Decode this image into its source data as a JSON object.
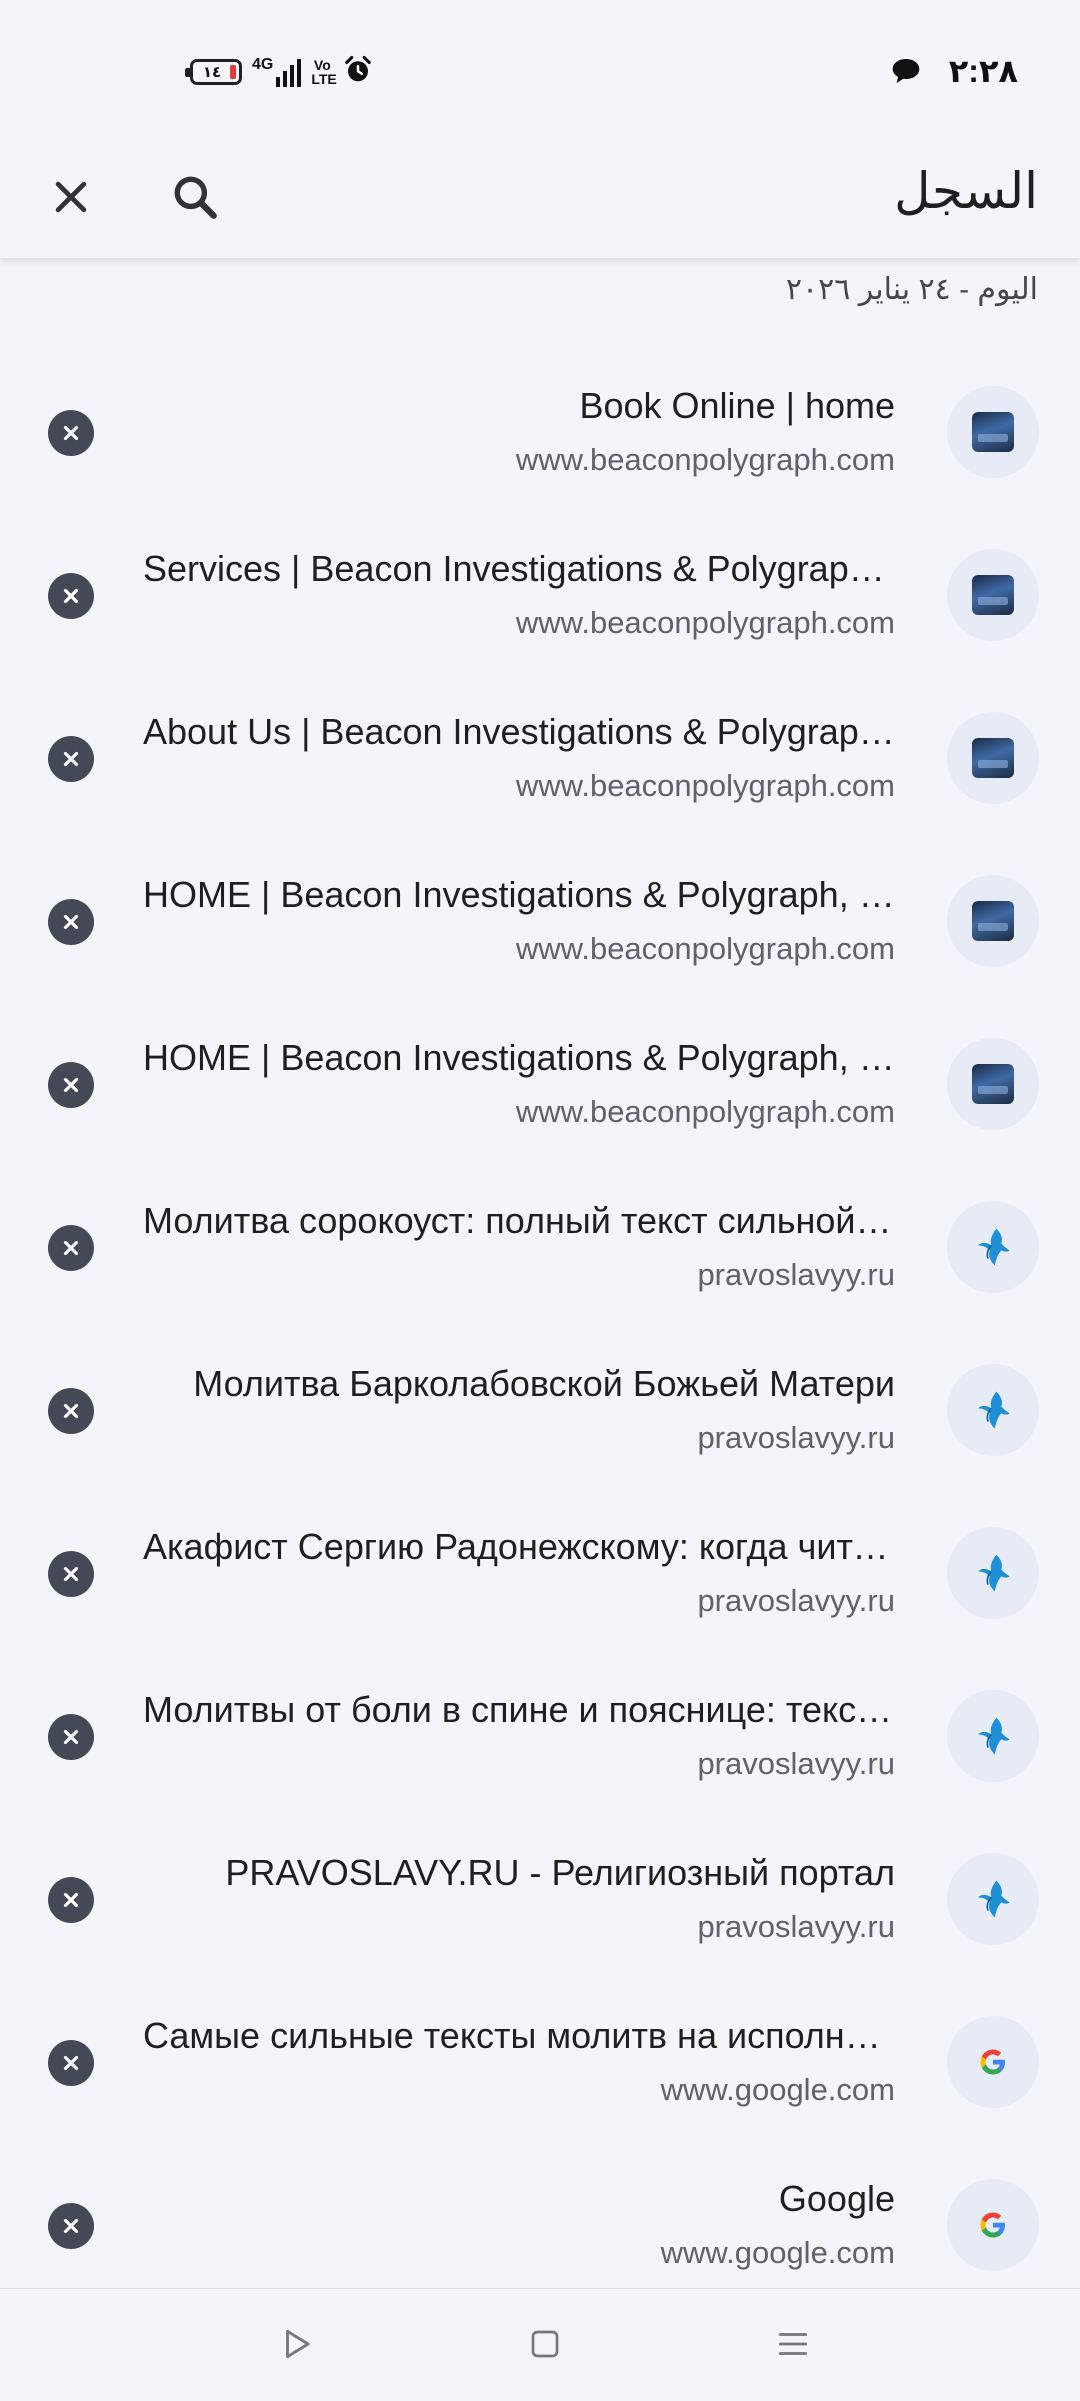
{
  "status_bar": {
    "time": "٢:٢٨",
    "battery_level": "١٤",
    "network": "4G",
    "volte": "Vo\nLTE",
    "icons": [
      "battery-icon",
      "signal-icon",
      "volte-icon",
      "alarm-icon",
      "chat-bubble-icon"
    ]
  },
  "app_bar": {
    "title": "السجل",
    "icons": [
      "close-icon",
      "search-icon"
    ]
  },
  "date_header": "اليوم - ٢٤ يناير ٢٠٢٦",
  "history": [
    {
      "title": "Book Online | home",
      "url": "www.beaconpolygraph.com",
      "favicon": "beacon"
    },
    {
      "title": "Services | Beacon Investigations & Polygraph, LLC",
      "url": "www.beaconpolygraph.com",
      "favicon": "beacon"
    },
    {
      "title": "About Us | Beacon Investigations & Polygraph, LLC",
      "url": "www.beaconpolygraph.com",
      "favicon": "beacon"
    },
    {
      "title": "HOME | Beacon Investigations & Polygraph, LLC",
      "url": "www.beaconpolygraph.com",
      "favicon": "beacon"
    },
    {
      "title": "HOME | Beacon Investigations & Polygraph, LLC",
      "url": "www.beaconpolygraph.com",
      "favicon": "beacon"
    },
    {
      "title": "Молитва сорокоуст: полный текст сильной молитвы",
      "url": "pravoslavyy.ru",
      "favicon": "dove"
    },
    {
      "title": "Молитва Барколабовской Божьей Матери",
      "url": "pravoslavyy.ru",
      "favicon": "dove"
    },
    {
      "title": "Акафист Сергию Радонежскому: когда читать",
      "url": "pravoslavyy.ru",
      "favicon": "dove"
    },
    {
      "title": "Молитвы от боли в спине и пояснице: тексты",
      "url": "pravoslavyy.ru",
      "favicon": "dove"
    },
    {
      "title": "PRAVOSLAVY.RU - Религиозный портал",
      "url": "pravoslavyy.ru",
      "favicon": "dove"
    },
    {
      "title": "Самые сильные тексты молитв на исполнение желаний",
      "url": "www.google.com",
      "favicon": "google"
    },
    {
      "title": "Google",
      "url": "www.google.com",
      "favicon": "google"
    }
  ],
  "nav_bar": {
    "icons": [
      "back-icon",
      "home-icon",
      "recents-icon"
    ]
  },
  "colors": {
    "background": "#f3f5fb",
    "remove_button": "#444a55",
    "favicon_bg": "#e7ebf6",
    "battery_low": "#e53935",
    "dove_blue": "#1f8fd6"
  }
}
